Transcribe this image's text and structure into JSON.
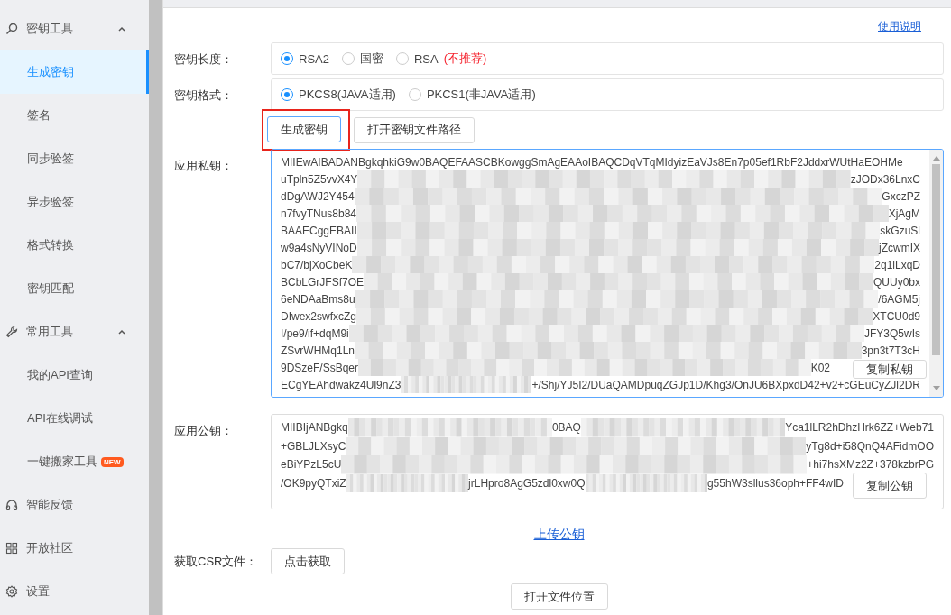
{
  "sidebar": {
    "items": [
      {
        "kind": "group",
        "label": "密钥工具",
        "expanded": true,
        "children": [
          {
            "label": "生成密钥",
            "selected": true
          },
          {
            "label": "签名",
            "selected": false
          },
          {
            "label": "同步验签",
            "selected": false
          },
          {
            "label": "异步验签",
            "selected": false
          },
          {
            "label": "格式转换",
            "selected": false
          },
          {
            "label": "密钥匹配",
            "selected": false
          }
        ]
      },
      {
        "kind": "group",
        "label": "常用工具",
        "expanded": true,
        "children": [
          {
            "label": "我的API查询",
            "selected": false
          },
          {
            "label": "API在线调试",
            "selected": false
          },
          {
            "label": "一键搬家工具",
            "badge": "NEW",
            "selected": false
          }
        ]
      },
      {
        "kind": "link",
        "label": "智能反馈"
      },
      {
        "kind": "link",
        "label": "开放社区"
      },
      {
        "kind": "link",
        "label": "设置"
      }
    ]
  },
  "help_link": "使用说明",
  "key_length": {
    "label": "密钥长度：",
    "options": [
      {
        "label": "RSA2",
        "selected": true
      },
      {
        "label": "国密",
        "selected": false
      },
      {
        "label": "RSA",
        "note": "(不推荐)",
        "selected": false
      }
    ]
  },
  "key_format": {
    "label": "密钥格式：",
    "options": [
      {
        "label": "PKCS8(JAVA适用)",
        "selected": true
      },
      {
        "label": "PKCS1(非JAVA适用)",
        "selected": false
      }
    ]
  },
  "actions": [
    {
      "label": "生成密钥",
      "highlighted": true
    },
    {
      "label": "打开密钥文件路径",
      "highlighted": false
    }
  ],
  "private_key": {
    "label": "应用私钥：",
    "copy_button": "复制私钥",
    "lines": [
      [
        "MIIEwAIBADANBgkqhkiG9w0BAQEFAASCBKowggSmAgEAAoIBAQCDqVTqMIdyizEaVJs8En7p05ef1RbF2JddxrWUtHaEOHMe"
      ],
      [
        "uTpln5Z5vvX4Y",
        "zJODx36LnxC"
      ],
      [
        "dDgAWJ2Y454",
        "GxczPZ"
      ],
      [
        "n7fvyTNus8b84",
        "XjAgM"
      ],
      [
        "BAAECggEBAII",
        "skGzuSl"
      ],
      [
        "w9a4sNyVINoD",
        "jZcwmIX"
      ],
      [
        "bC7/bjXoCbeK",
        "2q1lLxqD"
      ],
      [
        "BCbLGrJFSf7OE",
        "QUUy0bx"
      ],
      [
        "6eNDAaBms8u",
        "/6AGM5j"
      ],
      [
        "DIwex2swfxcZg",
        "XTCU0d9"
      ],
      [
        "I/pe9/if+dqM9i",
        "JFY3Q5wIs"
      ],
      [
        "ZSvrWHMq1Ln",
        "3pn3t7T3cH"
      ],
      [
        "9DSzeF/SsBqer",
        "K02"
      ],
      [
        "ECgYEAhdwakz4Ul9nZ3",
        "+/Shj/YJ5I2/DUaQAMDpuqZGJp1D/Khg3/OnJU6BXpxdD42+v2+cGEuCyZJl2DR"
      ]
    ]
  },
  "public_key": {
    "label": "应用公钥：",
    "copy_button": "复制公钥",
    "lines": [
      [
        "MIIBIjANBgkq",
        "0BAQ",
        "Yca1lLR2hDhzHrk6ZZ+Web71"
      ],
      [
        "+GBLJLXsyC",
        "yTg8d+i58QnQ4AFidmOO"
      ],
      [
        "eBiYPzL5cU",
        "+hi7hsXMz2Z+378kzbrPG"
      ],
      [
        "/OK9pyQTxiZ",
        "jrLHpro8AgG5zdl0xw0Q",
        "g55hW3sllus36oph+FF4wID"
      ]
    ]
  },
  "upload_link": "上传公钥",
  "csr": {
    "label": "获取CSR文件：",
    "button": "点击获取"
  },
  "open_folder_button": "打开文件位置"
}
